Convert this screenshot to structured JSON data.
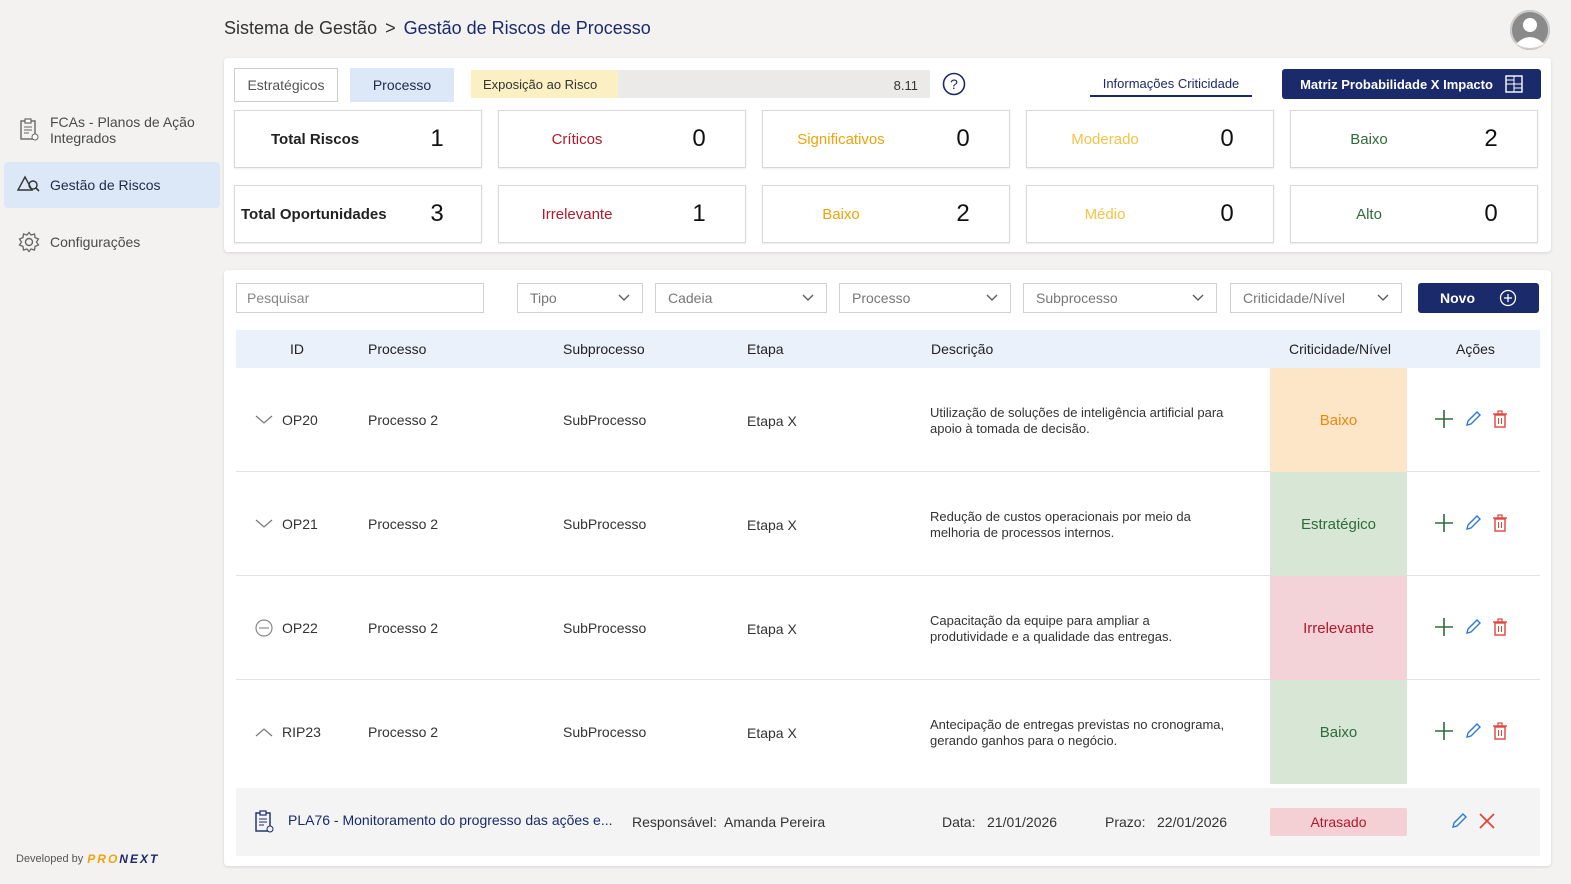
{
  "breadcrumb": {
    "root": "Sistema de Gestão",
    "separator": ">",
    "current": "Gestão de Riscos de Processo"
  },
  "sidebar": {
    "items": [
      {
        "label_line1": "FCAs - Planos de Ação",
        "label_line2": "Integrados",
        "icon": "clipboard-icon"
      },
      {
        "label": "Gestão de Riscos",
        "icon": "risk-search-icon",
        "active": true
      },
      {
        "label": "Configurações",
        "icon": "gear-icon"
      }
    ],
    "developed_by": "Developed by",
    "brand_part1": "PRO",
    "brand_part2": "NEXT"
  },
  "tabs": [
    {
      "label": "Estratégicos"
    },
    {
      "label": "Processo",
      "active": true
    }
  ],
  "exposure": {
    "label": "Exposição ao Risco",
    "value": "8.11",
    "fill_fraction": 0.32
  },
  "info_link": "Informações Criticidade",
  "matrix_button": "Matriz Probabilidade X Impacto",
  "summary": {
    "risks": [
      {
        "label": "Total Riscos",
        "value": "1",
        "color": "#222222"
      },
      {
        "label": "Críticos",
        "value": "0",
        "color": "#b2182b"
      },
      {
        "label": "Significativos",
        "value": "0",
        "color": "#f0a30a"
      },
      {
        "label": "Moderado",
        "value": "0",
        "color": "#f6c343"
      },
      {
        "label": "Baixo",
        "value": "2",
        "color": "#2e6b3a"
      }
    ],
    "opportunities": [
      {
        "label": "Total Oportunidades",
        "value": "3",
        "color": "#222222"
      },
      {
        "label": "Irrelevante",
        "value": "1",
        "color": "#b2182b"
      },
      {
        "label": "Baixo",
        "value": "2",
        "color": "#f0a30a"
      },
      {
        "label": "Médio",
        "value": "0",
        "color": "#f6c343"
      },
      {
        "label": "Alto",
        "value": "0",
        "color": "#2e6b3a"
      }
    ]
  },
  "filters": {
    "search_placeholder": "Pesquisar",
    "tipo": "Tipo",
    "cadeia": "Cadeia",
    "processo": "Processo",
    "subprocesso": "Subprocesso",
    "criticidade": "Criticidade/Nível",
    "novo": "Novo"
  },
  "table": {
    "headers": [
      "ID",
      "Processo",
      "Subprocesso",
      "Etapa",
      "Descrição",
      "Criticidade/Nível",
      "Ações"
    ],
    "rows": [
      {
        "id": "OP20",
        "processo": "Processo 2",
        "subprocesso": "SubProcesso",
        "etapa": "Etapa X",
        "desc1": "Utilização de soluções de inteligência artificial para",
        "desc2": "apoio à tomada de decisão.",
        "crit": "Baixo",
        "crit_bg": "#fde5c8",
        "crit_fg": "#e8890c",
        "expander": "chevron-down"
      },
      {
        "id": "OP21",
        "processo": "Processo 2",
        "subprocesso": "SubProcesso",
        "etapa": "Etapa X",
        "desc1": "Redução de custos operacionais por meio da",
        "desc2": "melhoria de processos internos.",
        "crit": "Estratégico",
        "crit_bg": "#d8e6d6",
        "crit_fg": "#2e6b3a",
        "expander": "chevron-down"
      },
      {
        "id": "OP22",
        "processo": "Processo 2",
        "subprocesso": "SubProcesso",
        "etapa": "Etapa X",
        "desc1": "Capacitação da equipe para ampliar a",
        "desc2": "produtividade e a qualidade das entregas.",
        "crit": "Irrelevante",
        "crit_bg": "#f3d3d7",
        "crit_fg": "#b2182b",
        "expander": "minus-circle"
      },
      {
        "id": "RIP23",
        "processo": "Processo 2",
        "subprocesso": "SubProcesso",
        "etapa": "Etapa X",
        "desc1": "Antecipação de entregas previstas no cronograma,",
        "desc2": "gerando ganhos para o negócio.",
        "crit": "Baixo",
        "crit_bg": "#d8e6d6",
        "crit_fg": "#2e6b3a",
        "expander": "chevron-up"
      }
    ],
    "subrow": {
      "title": "PLA76 - Monitoramento do progresso das ações e...",
      "resp_label": "Responsável:",
      "resp_value": "Amanda Pereira",
      "data_label": "Data:",
      "data_value": "21/01/2026",
      "prazo_label": "Prazo:",
      "prazo_value": "22/01/2026",
      "status": "Atrasado"
    }
  }
}
